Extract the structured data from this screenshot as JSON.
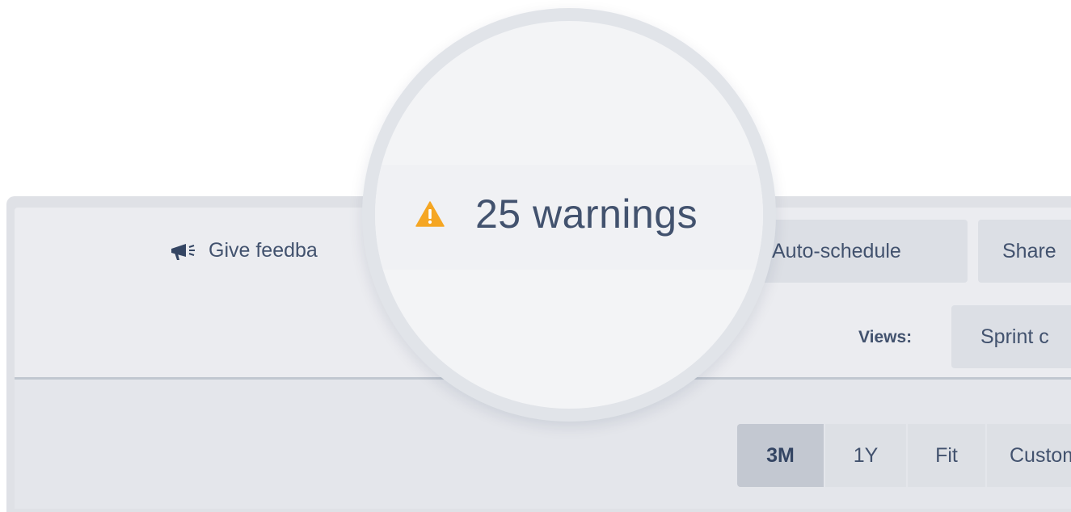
{
  "toolbar": {
    "feedback_label": "Give feedba",
    "auto_schedule_label": "Auto-schedule",
    "share_label": "Share"
  },
  "views": {
    "label": "Views:",
    "selected": "Sprint c"
  },
  "time_range": {
    "options": [
      "3M",
      "1Y",
      "Fit",
      "Custom"
    ],
    "selected": "3M"
  },
  "warnings": {
    "label": "25 warnings",
    "count": 25
  },
  "icons": {
    "feedback": "megaphone-icon",
    "warning": "warning-triangle-icon"
  },
  "colors": {
    "warning": "#f5a623",
    "text": "#42526e",
    "panel": "#ebecf0"
  }
}
